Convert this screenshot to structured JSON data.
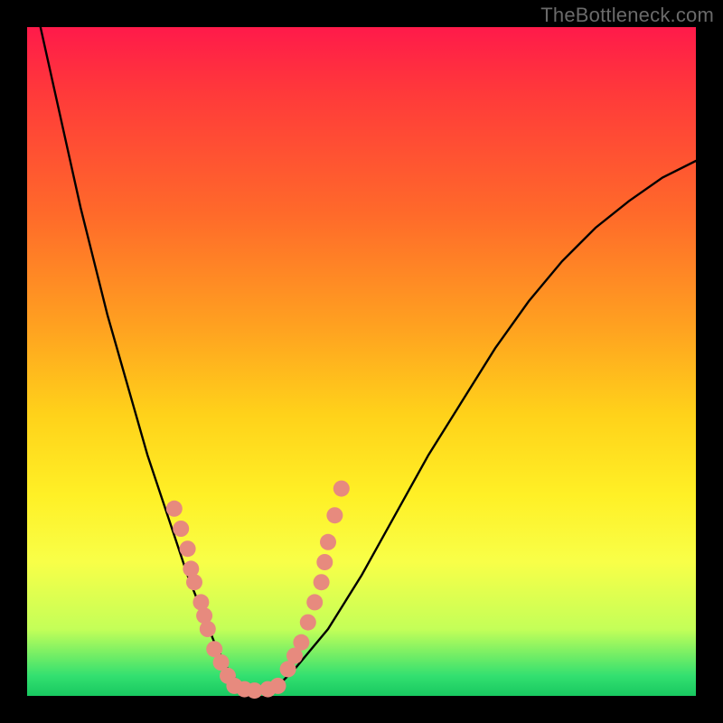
{
  "watermark": "TheBottleneck.com",
  "chart_data": {
    "type": "line",
    "title": "",
    "xlabel": "",
    "ylabel": "",
    "xlim": [
      0,
      100
    ],
    "ylim": [
      0,
      100
    ],
    "curve": {
      "name": "bottleneck-curve",
      "x": [
        2,
        4,
        6,
        8,
        10,
        12,
        14,
        16,
        18,
        20,
        22,
        24,
        26,
        28,
        30,
        32,
        34,
        36,
        38,
        40,
        45,
        50,
        55,
        60,
        65,
        70,
        75,
        80,
        85,
        90,
        95,
        100
      ],
      "y": [
        100,
        91,
        82,
        73,
        65,
        57,
        50,
        43,
        36,
        30,
        24,
        18,
        13,
        8,
        4,
        1.5,
        0.5,
        0.8,
        2,
        4,
        10,
        18,
        27,
        36,
        44,
        52,
        59,
        65,
        70,
        74,
        77.5,
        80
      ]
    },
    "series": [
      {
        "name": "left-cluster",
        "type": "scatter",
        "points": [
          {
            "x": 22,
            "y": 28
          },
          {
            "x": 23,
            "y": 25
          },
          {
            "x": 24,
            "y": 22
          },
          {
            "x": 24.5,
            "y": 19
          },
          {
            "x": 25,
            "y": 17
          },
          {
            "x": 26,
            "y": 14
          },
          {
            "x": 26.5,
            "y": 12
          },
          {
            "x": 27,
            "y": 10
          },
          {
            "x": 28,
            "y": 7
          },
          {
            "x": 29,
            "y": 5
          },
          {
            "x": 30,
            "y": 3
          }
        ]
      },
      {
        "name": "bottom-cluster",
        "type": "scatter",
        "points": [
          {
            "x": 31,
            "y": 1.5
          },
          {
            "x": 32.5,
            "y": 1
          },
          {
            "x": 34,
            "y": 0.8
          },
          {
            "x": 36,
            "y": 1
          },
          {
            "x": 37.5,
            "y": 1.5
          }
        ]
      },
      {
        "name": "right-cluster",
        "type": "scatter",
        "points": [
          {
            "x": 39,
            "y": 4
          },
          {
            "x": 40,
            "y": 6
          },
          {
            "x": 41,
            "y": 8
          },
          {
            "x": 42,
            "y": 11
          },
          {
            "x": 43,
            "y": 14
          },
          {
            "x": 44,
            "y": 17
          },
          {
            "x": 44.5,
            "y": 20
          },
          {
            "x": 45,
            "y": 23
          },
          {
            "x": 46,
            "y": 27
          },
          {
            "x": 47,
            "y": 31
          }
        ]
      }
    ],
    "gradient_stops": [
      {
        "pos": 0,
        "color": "#ff1a4a"
      },
      {
        "pos": 50,
        "color": "#ffd21a"
      },
      {
        "pos": 100,
        "color": "#18c860"
      }
    ]
  }
}
